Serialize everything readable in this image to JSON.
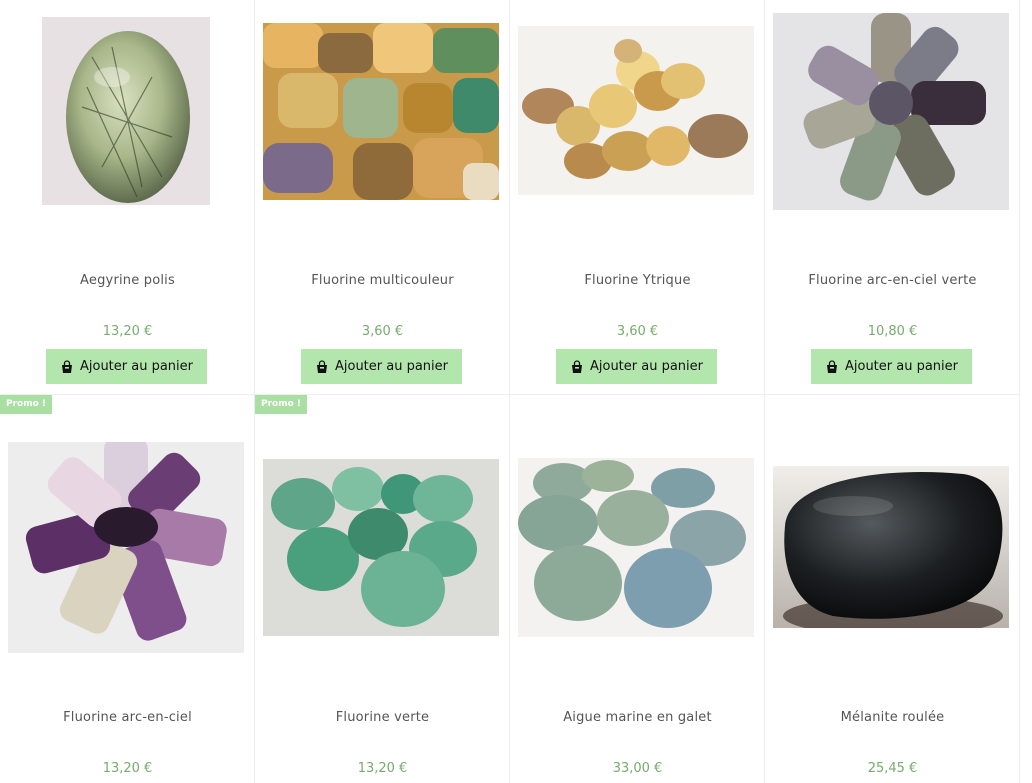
{
  "products": [
    {
      "title": "Aegyrine polis",
      "price": "13,20 €",
      "image": "aegyrine-polished-stone",
      "promo": ""
    },
    {
      "title": "Fluorine multicouleur",
      "price": "3,60 €",
      "image": "multicolor-fluorite-stones",
      "promo": ""
    },
    {
      "title": "Fluorine Ytrique",
      "price": "3,60 €",
      "image": "yttrium-fluorite-stones",
      "promo": ""
    },
    {
      "title": "Fluorine arc-en-ciel verte",
      "price": "10,80 €",
      "image": "green-rainbow-fluorite-stones",
      "promo": ""
    },
    {
      "title": "Fluorine arc-en-ciel",
      "price": "13,20 €",
      "image": "rainbow-fluorite-stones",
      "promo": "Promo !"
    },
    {
      "title": "Fluorine verte",
      "price": "13,20 €",
      "image": "green-fluorite-stones",
      "promo": "Promo !"
    },
    {
      "title": "Aigue marine en galet",
      "price": "33,00 €",
      "image": "aquamarine-pebbles",
      "promo": ""
    },
    {
      "title": "Mélanite roulée",
      "price": "25,45 €",
      "image": "tumbled-melanite-stone",
      "promo": ""
    }
  ],
  "button": {
    "add_to_cart": "Ajouter au panier"
  },
  "colors": {
    "accent": "#b3e6ad",
    "price": "#78ab6e",
    "promo": "#a9dfa3"
  }
}
